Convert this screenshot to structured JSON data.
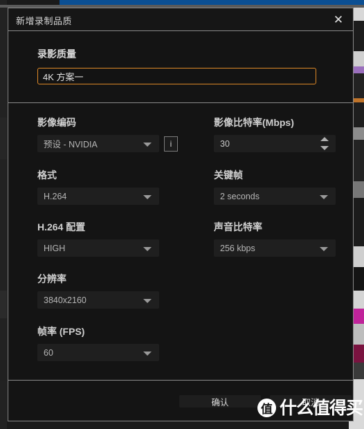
{
  "window": {
    "title": "新增录制品质",
    "close_icon": "close-icon"
  },
  "name_section": {
    "label": "录影质量",
    "value": "4K 方案一",
    "placeholder": "4K 方案一"
  },
  "settings": {
    "left_column": [
      {
        "label": "影像编码",
        "value": "预设 - NVIDIA",
        "control": "select",
        "has_info_button": true,
        "info_label": "i"
      },
      {
        "label": "格式",
        "value": "H.264",
        "control": "select"
      },
      {
        "label": "H.264 配置",
        "value": "HIGH",
        "control": "select"
      },
      {
        "label": "分辨率",
        "value": "3840x2160",
        "control": "select"
      },
      {
        "label": "帧率 (FPS)",
        "value": "60",
        "control": "select"
      }
    ],
    "right_column": [
      {
        "label": "影像比特率(Mbps)",
        "value": "30",
        "control": "spinner"
      },
      {
        "label": "关键帧",
        "value": "2 seconds",
        "control": "select"
      },
      {
        "label": "声音比特率",
        "value": "256 kbps",
        "control": "select"
      }
    ]
  },
  "footer": {
    "confirm_label": "确认",
    "cancel_label": "取消"
  },
  "watermark": {
    "badge": "值",
    "text": "什么值得买"
  },
  "colors": {
    "dialog_background": "#141414",
    "field_background": "#1f1f1f",
    "border": "#8a8a8a",
    "accent_orange": "#e08a28",
    "text_primary": "#d6d6d6",
    "text_secondary": "#b6b6b6",
    "bg_blue_strip": "#0b4f93"
  }
}
